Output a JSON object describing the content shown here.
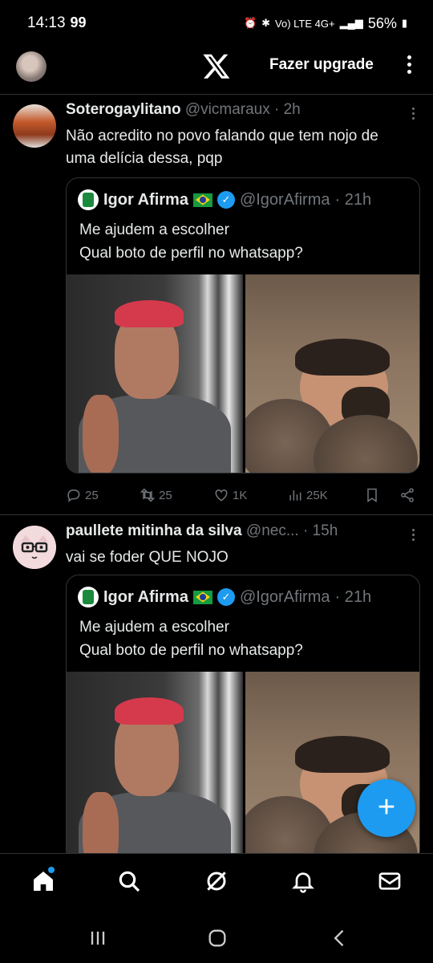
{
  "status_bar": {
    "time": "14:13",
    "notif": "99",
    "network": "Vo) LTE 4G+",
    "battery": "56%"
  },
  "header": {
    "upgrade_label": "Fazer upgrade"
  },
  "tweets": [
    {
      "name": "Soterogaylitano",
      "handle": "@vicmaraux",
      "time": " · 2h",
      "text": "Não acredito no povo falando que tem nojo de uma delícia dessa, pqp",
      "quote": {
        "name": "Igor Afirma",
        "handle": "@IgorAfirma",
        "time": " · 21h",
        "text_line1": "Me ajudem a escolher",
        "text_line2": "Qual boto de perfil no whatsapp?"
      },
      "stats": {
        "replies": "25",
        "retweets": "25",
        "likes": "1K",
        "views": "25K"
      }
    },
    {
      "name": "paullete mitinha da silva",
      "handle": "@nec...",
      "time": " · 15h",
      "text": "vai se foder QUE NOJO",
      "quote": {
        "name": "Igor Afirma",
        "handle": "@IgorAfirma",
        "time": " · 21h",
        "text_line1": "Me ajudem a escolher",
        "text_line2": "Qual boto de perfil no whatsapp?"
      }
    }
  ],
  "fab": {
    "icon": "plus-icon",
    "label": "+"
  },
  "bottom_nav": [
    "home-icon",
    "search-icon",
    "grok-icon",
    "bell-icon",
    "mail-icon"
  ],
  "colors": {
    "accent": "#1d9bf0",
    "muted": "#71767b",
    "border": "#2f3336"
  }
}
